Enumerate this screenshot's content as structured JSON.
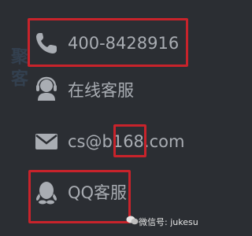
{
  "contacts": {
    "phone": {
      "icon": "phone-icon",
      "text": "400-8428916"
    },
    "online_service": {
      "icon": "headset-support-icon",
      "text": "在线客服"
    },
    "email": {
      "icon": "mail-icon",
      "text": "cs@b",
      "text2": "168",
      "text3": ".com"
    },
    "qq_service": {
      "icon": "qq-penguin-icon",
      "text": "QQ客服"
    }
  },
  "watermark": {
    "left": "聚客",
    "bottom": "微信号: jukesu"
  },
  "colors": {
    "background": "#2b2e33",
    "text": "#a9adb3",
    "highlight": "#c8232b"
  }
}
